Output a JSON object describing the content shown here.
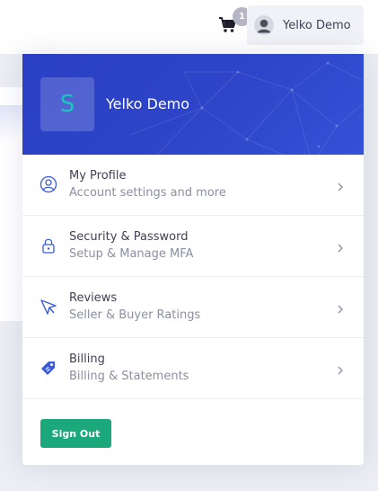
{
  "header": {
    "cart_count": "1",
    "user_name": "Yelko Demo"
  },
  "dropdown": {
    "avatar_letter": "S",
    "user_name": "Yelko Demo",
    "items": [
      {
        "title": "My Profile",
        "subtitle": "Account settings and more",
        "icon": "user-circle-icon"
      },
      {
        "title": "Security & Password",
        "subtitle": "Setup & Manage MFA",
        "icon": "lock-icon"
      },
      {
        "title": "Reviews",
        "subtitle": "Seller & Buyer Ratings",
        "icon": "paper-plane-icon"
      },
      {
        "title": "Billing",
        "subtitle": "Billing & Statements",
        "icon": "price-tag-icon"
      }
    ],
    "sign_out_label": "Sign Out"
  },
  "colors": {
    "header_blue": "#2e45c9",
    "icon_blue": "#3b5bdb",
    "sign_out_green": "#1ba97b",
    "avatar_letter": "#1bc5bd"
  }
}
